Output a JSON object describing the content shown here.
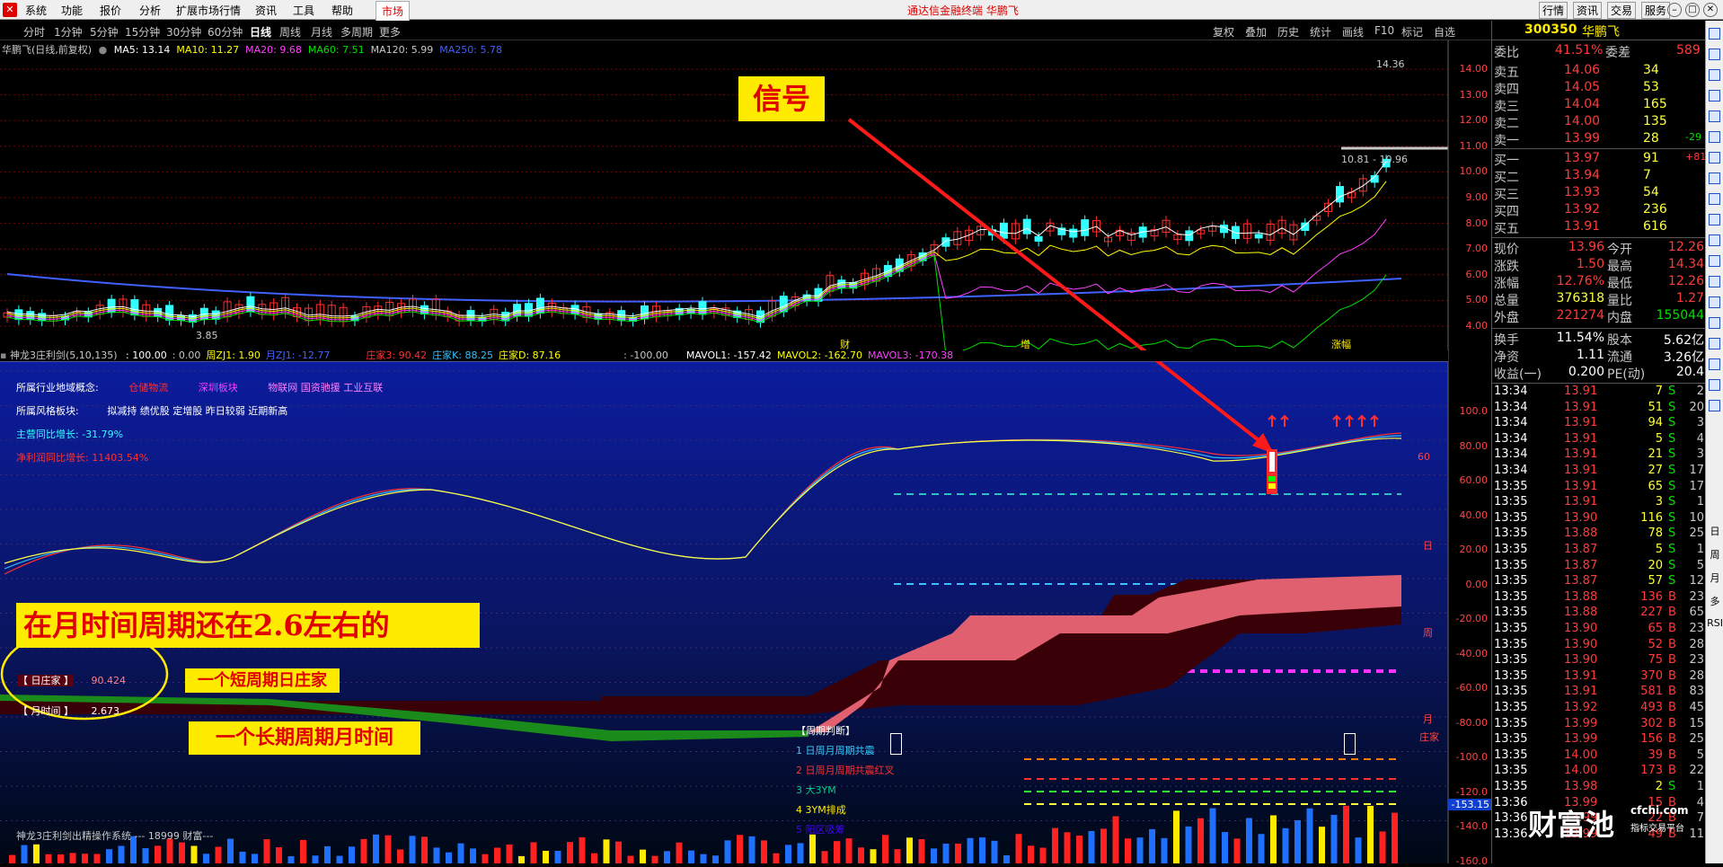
{
  "app": {
    "menu": [
      "系统",
      "功能",
      "报价",
      "分析",
      "扩展市场行情",
      "资讯",
      "工具",
      "帮助"
    ],
    "market_btn": "市场",
    "title": "通达信金融终端  华鹏飞",
    "right_buttons": [
      "行情",
      "资讯",
      "交易",
      "服务"
    ],
    "logo": "TDX"
  },
  "periods": {
    "items": [
      "分时",
      "1分钟",
      "5分钟",
      "15分钟",
      "30分钟",
      "60分钟",
      "日线",
      "周线",
      "月线",
      "多周期",
      "更多"
    ],
    "active": "日线",
    "tools": [
      "复权",
      "叠加",
      "历史",
      "统计",
      "画线",
      "F10",
      "标记",
      "自选"
    ]
  },
  "main_chart": {
    "title": "华鹏飞(日线,前复权)",
    "ma_labels": [
      {
        "text": "MA5: 13.14",
        "color": "#ffffff"
      },
      {
        "text": "MA10: 11.27",
        "color": "#ffff00"
      },
      {
        "text": "MA20: 9.68",
        "color": "#ff40ff"
      },
      {
        "text": "MA60: 7.51",
        "color": "#00e000"
      },
      {
        "text": "MA120: 5.99",
        "color": "#c8c8c8"
      },
      {
        "text": "MA250: 5.78",
        "color": "#4060ff"
      }
    ],
    "price_axis": [
      "14.00",
      "13.00",
      "12.00",
      "11.00",
      "10.00",
      "9.00",
      "8.00",
      "7.00",
      "6.00",
      "5.00",
      "4.00"
    ],
    "label_high": "14.36",
    "label_mid": "10.81 - 10.96",
    "label_low": "3.85",
    "marker_cai": "财",
    "marker_zeng": "增",
    "marker_zt": "涨幅"
  },
  "indicator": {
    "title": "神龙3庄利剑(5,10,135)",
    "values": [
      {
        "text": ": 100.00",
        "color": "#ffffff"
      },
      {
        "text": ": 0.00",
        "color": "#c8c8c8"
      },
      {
        "text": "周ZJ1: 1.90",
        "color": "#ffff00"
      },
      {
        "text": "月ZJ1: -12.77",
        "color": "#4060ff"
      },
      {
        "text": "庄家3: 90.42",
        "color": "#ff3030"
      },
      {
        "text": "庄家K: 88.25",
        "color": "#30c0ff"
      },
      {
        "text": "庄家D: 87.16",
        "color": "#ffff00"
      },
      {
        "text": ": -100.00",
        "color": "#c8c8c8"
      },
      {
        "text": "MAVOL1: -157.42",
        "color": "#ffffff"
      },
      {
        "text": "MAVOL2: -162.70",
        "color": "#ffff00"
      },
      {
        "text": "MAVOL3: -170.38",
        "color": "#ff40ff"
      }
    ],
    "axis": [
      "100.0",
      "80.00",
      "60.00",
      "40.00",
      "20.00",
      "0.00",
      "-20.00",
      "-40.00",
      "-60.00",
      "-80.00",
      "-100.0",
      "-120.0",
      "-140.0",
      "-160.0"
    ],
    "axis_highlight": "-153.15",
    "info": {
      "industry_label": "所属行业地域概念:",
      "industry_values": [
        "仓储物流",
        "深圳板块",
        "物联网 国资驰援 工业互联"
      ],
      "style_label": "所属风格板块:",
      "style_value": "拟减持 绩优股 定增股 昨日较弱 近期新高",
      "revenue": "主营同比增长: -31.79%",
      "profit": "净利润同比增长: 11403.54%"
    },
    "line_labels": {
      "l60": "60",
      "day": "日",
      "week": "周",
      "month": "月",
      "zhuang": "庄家"
    },
    "period_judge": {
      "title": "【周期判断】",
      "items": [
        "1 日周月周期共震",
        "2 日周月周期共震红叉",
        "3 大3YM",
        "4 3YM排成",
        "5 阳区吸筹"
      ]
    },
    "legend_box": {
      "day_label": "【 日庄家 】",
      "day_value": "90.424",
      "month_label": "【 月时间 】",
      "month_value": "2.673"
    },
    "footer": "神龙3庄利剑出精操作系统 ---  18999 财富---"
  },
  "annotations": {
    "signal": "信号",
    "month_note": "在月时间周期还在2.6左右的",
    "short_note": "一个短周期日庄家",
    "long_note": "一个长期周期月时间"
  },
  "quote": {
    "code": "300350",
    "name": "华鹏飞",
    "weibi": {
      "label": "委比",
      "value": "41.51%",
      "label2": "委差",
      "value2": "589"
    },
    "asks": [
      {
        "label": "卖五",
        "price": "14.06",
        "vol": "34"
      },
      {
        "label": "卖四",
        "price": "14.05",
        "vol": "53"
      },
      {
        "label": "卖三",
        "price": "14.04",
        "vol": "165"
      },
      {
        "label": "卖二",
        "price": "14.00",
        "vol": "135"
      },
      {
        "label": "卖一",
        "price": "13.99",
        "vol": "28",
        "chg": "-29"
      }
    ],
    "bids": [
      {
        "label": "买一",
        "price": "13.97",
        "vol": "91",
        "chg": "+81"
      },
      {
        "label": "买二",
        "price": "13.94",
        "vol": "7"
      },
      {
        "label": "买三",
        "price": "13.93",
        "vol": "54"
      },
      {
        "label": "买四",
        "price": "13.92",
        "vol": "236"
      },
      {
        "label": "买五",
        "price": "13.91",
        "vol": "616"
      }
    ],
    "stats": [
      {
        "l1": "现价",
        "v1": "13.96",
        "c1": "red",
        "l2": "今开",
        "v2": "12.26",
        "c2": "red"
      },
      {
        "l1": "涨跌",
        "v1": "1.50",
        "c1": "red",
        "l2": "最高",
        "v2": "14.34",
        "c2": "red"
      },
      {
        "l1": "涨幅",
        "v1": "12.76%",
        "c1": "red",
        "l2": "最低",
        "v2": "12.26",
        "c2": "red"
      },
      {
        "l1": "总量",
        "v1": "376318",
        "c1": "yel",
        "l2": "量比",
        "v2": "1.27",
        "c2": "red"
      },
      {
        "l1": "外盘",
        "v1": "221274",
        "c1": "red",
        "l2": "内盘",
        "v2": "155044",
        "c2": "grn"
      }
    ],
    "stats2": [
      {
        "l1": "换手",
        "v1": "11.54%",
        "l2": "股本",
        "v2": "5.62亿"
      },
      {
        "l1": "净资",
        "v1": "1.11",
        "l2": "流通",
        "v2": "3.26亿"
      },
      {
        "l1": "收益(一)",
        "v1": "0.200",
        "l2": "PE(动)",
        "v2": "20.4"
      }
    ],
    "ticks": [
      [
        "13:34",
        "13.91",
        "7",
        "S",
        "2"
      ],
      [
        "13:34",
        "13.91",
        "51",
        "S",
        "20"
      ],
      [
        "13:34",
        "13.91",
        "94",
        "S",
        "3"
      ],
      [
        "13:34",
        "13.91",
        "5",
        "S",
        "4"
      ],
      [
        "13:34",
        "13.91",
        "21",
        "S",
        "3"
      ],
      [
        "13:34",
        "13.91",
        "27",
        "S",
        "17"
      ],
      [
        "13:35",
        "13.91",
        "65",
        "S",
        "17"
      ],
      [
        "13:35",
        "13.91",
        "3",
        "S",
        "1"
      ],
      [
        "13:35",
        "13.90",
        "116",
        "S",
        "10"
      ],
      [
        "13:35",
        "13.88",
        "78",
        "S",
        "25"
      ],
      [
        "13:35",
        "13.87",
        "5",
        "S",
        "1"
      ],
      [
        "13:35",
        "13.87",
        "20",
        "S",
        "5"
      ],
      [
        "13:35",
        "13.87",
        "57",
        "S",
        "12"
      ],
      [
        "13:35",
        "13.88",
        "136",
        "B",
        "23"
      ],
      [
        "13:35",
        "13.88",
        "227",
        "B",
        "65"
      ],
      [
        "13:35",
        "13.90",
        "65",
        "B",
        "23"
      ],
      [
        "13:35",
        "13.90",
        "52",
        "B",
        "28"
      ],
      [
        "13:35",
        "13.90",
        "75",
        "B",
        "23"
      ],
      [
        "13:35",
        "13.91",
        "370",
        "B",
        "28"
      ],
      [
        "13:35",
        "13.91",
        "581",
        "B",
        "83"
      ],
      [
        "13:35",
        "13.92",
        "493",
        "B",
        "45"
      ],
      [
        "13:35",
        "13.99",
        "302",
        "B",
        "15"
      ],
      [
        "13:35",
        "13.99",
        "156",
        "B",
        "25"
      ],
      [
        "13:35",
        "14.00",
        "39",
        "B",
        "5"
      ],
      [
        "13:35",
        "14.00",
        "173",
        "B",
        "22"
      ],
      [
        "13:35",
        "13.98",
        "2",
        "S",
        "1"
      ],
      [
        "13:36",
        "13.99",
        "15",
        "B",
        "4"
      ],
      [
        "13:36",
        "13.99",
        "22",
        "B",
        "7"
      ],
      [
        "13:36",
        "13.99",
        "49",
        "B",
        "11"
      ]
    ],
    "watermark_cn": "财富池",
    "watermark_en": "cfchi.com",
    "watermark_sub": "指标交易平台"
  },
  "side_tabs": [
    "日",
    "周",
    "月",
    "多",
    "RSI"
  ]
}
